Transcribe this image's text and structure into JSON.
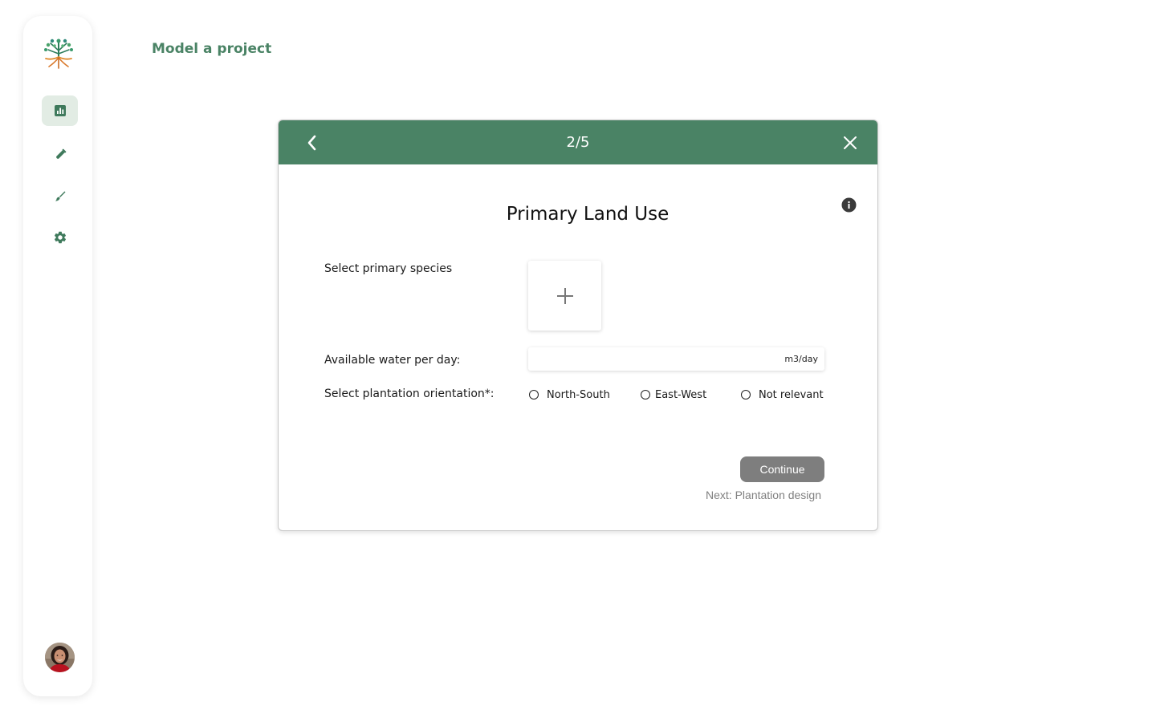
{
  "app": {
    "page_title": "Model a project"
  },
  "sidebar": {
    "items": [
      {
        "icon": "chart-icon",
        "active": true
      },
      {
        "icon": "test-tube-icon",
        "active": false
      },
      {
        "icon": "brush-icon",
        "active": false
      },
      {
        "icon": "gear-icon",
        "active": false
      }
    ],
    "logo": "tree-logo",
    "avatar": "user-avatar"
  },
  "modal": {
    "step": "2/5",
    "title": "Primary Land Use",
    "species_label": "Select primary species",
    "water_label": "Available water per day:",
    "water_value": "",
    "water_unit": "m3/day",
    "orientation_label": "Select plantation orientation*:",
    "orientation_options": [
      "North-South",
      "East-West",
      "Not relevant"
    ],
    "continue_label": "Continue",
    "next_hint": "Next: Plantation design"
  },
  "colors": {
    "brand_green": "#4a8365",
    "active_nav_bg": "#e2ece4",
    "button_disabled": "#7e7e7e",
    "hint_gray": "#808080"
  }
}
